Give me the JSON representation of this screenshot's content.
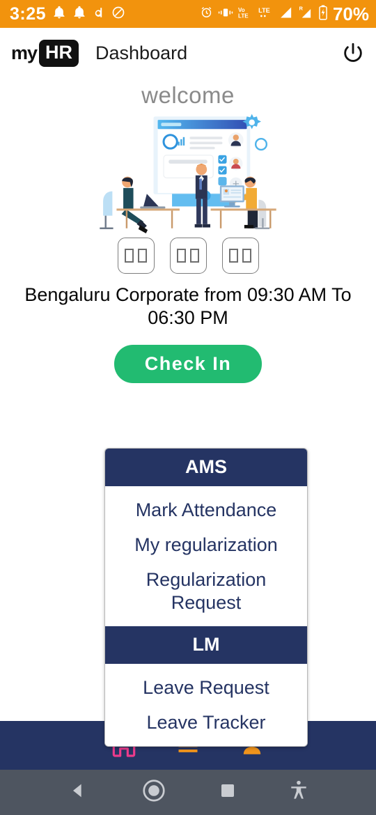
{
  "status_bar": {
    "time": "3:25",
    "battery_percent": "70%",
    "background_color": "#f2930d",
    "left_icons": [
      "notification-bell-icon",
      "notification-bell-icon",
      "letter-d-icon",
      "do-not-disturb-icon"
    ],
    "right_icons": [
      "alarm-clock-icon",
      "vibrate-icon",
      "volte-icon",
      "lte-icon",
      "signal-bars-icon",
      "roaming-signal-icon",
      "battery-icon"
    ]
  },
  "app_bar": {
    "logo_my": "my",
    "logo_hr": "HR",
    "title": "Dashboard",
    "power_icon": "power-icon"
  },
  "main": {
    "welcome_text": "welcome",
    "illustration": "hr-dashboard-office-illustration",
    "timer_boxes": [
      {
        "digits": [
          "tofu",
          "tofu"
        ]
      },
      {
        "digits": [
          "tofu",
          "tofu"
        ]
      },
      {
        "digits": [
          "tofu",
          "tofu"
        ]
      }
    ],
    "shift_text": "Bengaluru Corporate from 09:30 AM To 06:30 PM",
    "check_in_label": "Check In",
    "check_in_color": "#22bb71"
  },
  "menu_panel": {
    "header_color": "#253463",
    "sections": [
      {
        "title": "AMS",
        "items": [
          "Mark Attendance",
          "My regularization",
          "Regularization Request"
        ]
      },
      {
        "title": "LM",
        "items": [
          "Leave Request",
          "Leave Tracker"
        ]
      }
    ]
  },
  "bottom_nav": {
    "background_color": "#253463",
    "items": [
      {
        "name": "home-icon",
        "color": "#ec3b8b"
      },
      {
        "name": "menu-list-icon",
        "color": "#f0941c"
      },
      {
        "name": "profile-person-icon",
        "color": "#f0941c"
      }
    ]
  },
  "android_nav": {
    "background_color": "#4e5560",
    "buttons": [
      "back-icon",
      "home-icon",
      "recents-icon",
      "accessibility-icon"
    ]
  }
}
